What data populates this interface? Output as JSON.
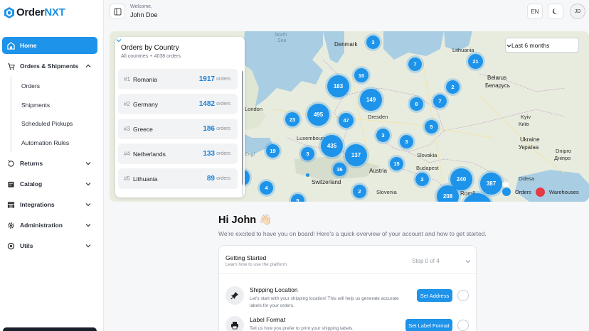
{
  "app": {
    "logo_text_a": "Order",
    "logo_text_b": "NXT",
    "brand_color": "#1e93ea"
  },
  "sidebar": {
    "items": [
      {
        "label": "Home",
        "icon": "home-icon",
        "active": true
      },
      {
        "label": "Orders & Shipments",
        "icon": "cart-icon",
        "expanded": true,
        "children": [
          "Orders",
          "Shipments",
          "Scheduled Pickups",
          "Automation Rules"
        ]
      },
      {
        "label": "Returns",
        "icon": "return-icon"
      },
      {
        "label": "Catalog",
        "icon": "catalog-icon"
      },
      {
        "label": "Integrations",
        "icon": "integrations-icon"
      },
      {
        "label": "Administration",
        "icon": "gear-icon"
      },
      {
        "label": "Utils",
        "icon": "utils-icon"
      }
    ]
  },
  "header": {
    "welcome": "Welcome,",
    "user_name": "John Doe",
    "language": "EN",
    "avatar_initials": "JD"
  },
  "map": {
    "period_select": "Last 6 months",
    "legend_orders": "Orders",
    "legend_warehouses": "Warehouses",
    "places": {
      "north_sea_1": "North",
      "north_sea_2": "Sea",
      "denmark": "Denmark",
      "lithuania": "Lithuania",
      "belarus_1": "Belarus",
      "belarus_2": "Беларусь",
      "london": "London",
      "dresden": "Dresden",
      "luxembourg": "Luxembourg",
      "ukraine_1": "Ukraine",
      "ukraine_2": "Україна",
      "kyiv_1": "Kyiv",
      "kyiv_2": "Київ",
      "dnipro_1": "Dnipro",
      "dnipro_2": "Дніпро",
      "slovakia": "Slovakia",
      "austria": "Austria",
      "budapest": "Budapest",
      "switzerland": "Switzerland",
      "slovenia": "Slovenia",
      "romania": "Româ",
      "odesa": "Odesa",
      "eng_channel": "Engl"
    },
    "clusters": [
      "3",
      "7",
      "21",
      "10",
      "183",
      "149",
      "2",
      "8",
      "7",
      "495",
      "23",
      "47",
      "5",
      "3",
      "3",
      "19",
      "3",
      "435",
      "137",
      "36",
      "15",
      "2",
      "240",
      "387",
      "4",
      "2",
      "208",
      "5"
    ]
  },
  "orders_panel": {
    "title": "Orders by Country",
    "subtitle_a": "All countries",
    "subtitle_sep": "•",
    "subtitle_b": "4038 orders",
    "unit": "orders",
    "countries": [
      {
        "rank": "#1",
        "name": "Romania",
        "count": "1917"
      },
      {
        "rank": "#2",
        "name": "Germany",
        "count": "1482"
      },
      {
        "rank": "#3",
        "name": "Greece",
        "count": "186"
      },
      {
        "rank": "#4",
        "name": "Netherlands",
        "count": "133"
      },
      {
        "rank": "#5",
        "name": "Lithuania",
        "count": "89"
      }
    ]
  },
  "welcome": {
    "greeting": "Hi John 👋🏻",
    "intro": "We're excited to have you on board! Here's a quick overview of your account and how to get started."
  },
  "getting_started": {
    "title": "Getting Started",
    "subtitle": "Learn how to use the platform",
    "step": "Step 0 of 4",
    "tasks": [
      {
        "name": "Shipping Location",
        "description": "Let's start with your shipping location! This will help us generate accurate labels for your orders.",
        "button": "Set Address",
        "icon": "pin-icon"
      },
      {
        "name": "Label Format",
        "description": "Tell us how you prefer to print your shipping labels.",
        "button": "Set Label Format",
        "icon": "printer-icon"
      }
    ]
  }
}
